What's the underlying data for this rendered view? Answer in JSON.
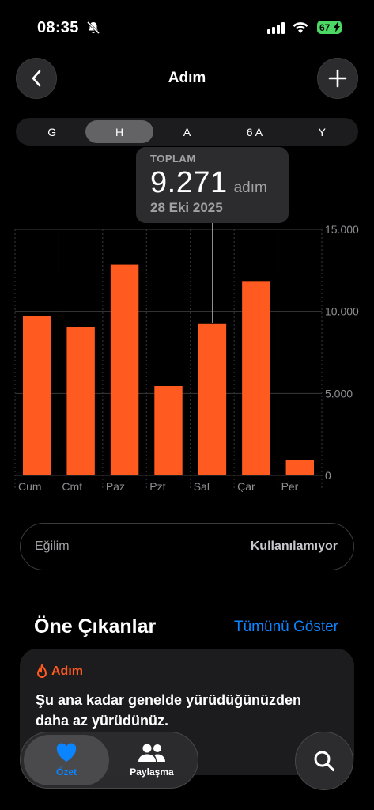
{
  "status": {
    "time": "08:35",
    "battery": "67"
  },
  "header": {
    "title": "Adım"
  },
  "segments": [
    "G",
    "H",
    "A",
    "6 A",
    "Y"
  ],
  "tooltip": {
    "label": "TOPLAM",
    "value": "9.271",
    "unit": "adım",
    "date": "28 Eki 2025"
  },
  "chart_data": {
    "type": "bar",
    "categories": [
      "Cum",
      "Cmt",
      "Paz",
      "Pzt",
      "Sal",
      "Çar",
      "Per"
    ],
    "values": [
      9700,
      9050,
      12850,
      5450,
      9271,
      11850,
      950
    ],
    "y_tick_labels": [
      "15.000",
      "10.000",
      "5.000",
      "0"
    ],
    "y_ticks": [
      15000,
      10000,
      5000,
      0
    ],
    "ylim": [
      0,
      15000
    ],
    "selected_index": 4,
    "bar_color": "#ff5a1f",
    "grid": true
  },
  "trend": {
    "label": "Eğilim",
    "value": "Kullanılamıyor"
  },
  "highlights": {
    "title": "Öne Çıkanlar",
    "show_all": "Tümünü Göster",
    "card_header": "Adım",
    "card_text": "Şu ana kadar genelde yürüdüğünüzden daha az yürüdünüz."
  },
  "tabbar": {
    "summary": "Özet",
    "sharing": "Paylaşma"
  },
  "colors": {
    "accent": "#0a84ff",
    "steps": "#ff5a1f",
    "battery": "#4cd964"
  }
}
